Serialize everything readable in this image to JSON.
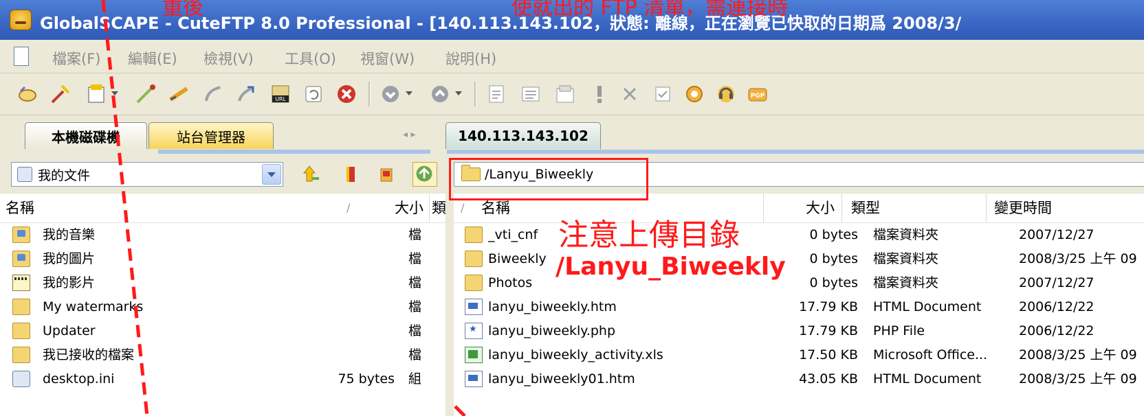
{
  "window": {
    "title": "GlobalSCAPE - CuteFTP 8.0 Professional - [140.113.143.102，狀態: 離線，正在瀏覽已快取的日期爲 2008/3/",
    "top_overlay_left": "重後",
    "top_overlay_right": "使就出的 FTP 清單，需連接時"
  },
  "menu": {
    "items": [
      {
        "label": "檔案(F)"
      },
      {
        "label": "編輯(E)"
      },
      {
        "label": "檢視(V)"
      },
      {
        "label": "工具(O)"
      },
      {
        "label": "視窗(W)"
      },
      {
        "label": "說明(H)"
      }
    ]
  },
  "toolbar": {
    "icons": [
      "connect-icon",
      "quick-connect-icon",
      "new-site-icon",
      "disconnect-icon",
      "reconnect-icon",
      "stop-icon",
      "transfer-icon",
      "url-icon",
      "refresh-icon",
      "cancel-icon",
      "download-icon",
      "upload-icon",
      "edit-icon",
      "view-icon",
      "properties-icon",
      "execute-icon",
      "delete-icon",
      "check-icon",
      "filter-icon",
      "help-icon",
      "pgp-icon"
    ],
    "url_badge": "URL",
    "pgp_badge": "PGP"
  },
  "tabs": {
    "local": "本機磁碟機",
    "site_manager": "站台管理器",
    "remote": "140.113.143.102",
    "arrows": "◂ ▸"
  },
  "local": {
    "path": "我的文件",
    "columns": {
      "name": "名稱",
      "sort": "/",
      "size": "大小",
      "type": "類"
    },
    "rows": [
      {
        "name": "我的音樂",
        "size": "",
        "type": "檔",
        "icon": "music-folder-icon"
      },
      {
        "name": "我的圖片",
        "size": "",
        "type": "檔",
        "icon": "pictures-folder-icon"
      },
      {
        "name": "我的影片",
        "size": "",
        "type": "檔",
        "icon": "videos-folder-icon"
      },
      {
        "name": "My watermarks",
        "size": "",
        "type": "檔",
        "icon": "folder-icon"
      },
      {
        "name": "Updater",
        "size": "",
        "type": "檔",
        "icon": "folder-icon"
      },
      {
        "name": "我已接收的檔案",
        "size": "",
        "type": "檔",
        "icon": "folder-icon"
      },
      {
        "name": "desktop.ini",
        "size": "75 bytes",
        "type": "組",
        "icon": "ini-file-icon"
      }
    ]
  },
  "remote": {
    "path": "/Lanyu_Biweekly",
    "columns": {
      "sort": "/",
      "name": "名稱",
      "size": "大小",
      "type": "類型",
      "modified": "變更時間"
    },
    "rows": [
      {
        "name": "_vti_cnf",
        "size": "0 bytes",
        "type": "檔案資料夾",
        "modified": "2007/12/27",
        "icon": "folder-icon"
      },
      {
        "name": "Biweekly",
        "size": "0 bytes",
        "type": "檔案資料夾",
        "modified": "2008/3/25 上午 09",
        "icon": "folder-icon"
      },
      {
        "name": "Photos",
        "size": "0 bytes",
        "type": "檔案資料夾",
        "modified": "2007/12/27",
        "icon": "folder-icon"
      },
      {
        "name": "lanyu_biweekly.htm",
        "size": "17.79 KB",
        "type": "HTML Document",
        "modified": "2006/12/22",
        "icon": "html-file-icon"
      },
      {
        "name": "lanyu_biweekly.php",
        "size": "17.79 KB",
        "type": "PHP File",
        "modified": "2006/12/22",
        "icon": "php-file-icon"
      },
      {
        "name": "lanyu_biweekly_activity.xls",
        "size": "17.50 KB",
        "type": "Microsoft Office...",
        "modified": "2008/3/25 上午 09",
        "icon": "excel-file-icon"
      },
      {
        "name": "lanyu_biweekly01.htm",
        "size": "43.05 KB",
        "type": "HTML Document",
        "modified": "2008/3/25 上午 09",
        "icon": "html-file-icon"
      }
    ]
  },
  "annotation": {
    "note_line1": "注意上傳目錄",
    "note_line2": "/Lanyu_Biweekly"
  },
  "colors": {
    "annotation_red": "#ff1a1a",
    "titlebar_blue": "#3a66c4",
    "chrome": "#ece9d8"
  }
}
